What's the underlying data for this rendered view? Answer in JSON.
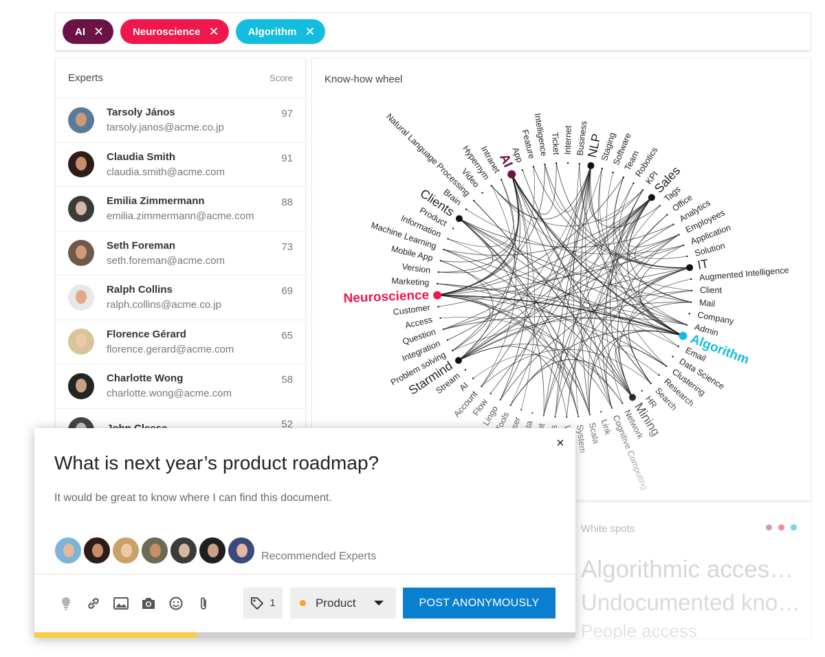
{
  "filters": [
    {
      "label": "AI",
      "color": "#6b1246"
    },
    {
      "label": "Neuroscience",
      "color": "#f0174a"
    },
    {
      "label": "Algorithm",
      "color": "#14bde0"
    }
  ],
  "experts_panel": {
    "title": "Experts",
    "score_label": "Score",
    "experts": [
      {
        "name": "Tarsoly János",
        "email": "tarsoly.janos@acme.co.jp",
        "score": "97"
      },
      {
        "name": "Claudia Smith",
        "email": "claudia.smith@acme.com",
        "score": "91"
      },
      {
        "name": "Emilia Zimmermann",
        "email": "emilia.zimmermann@acme.com",
        "score": "88"
      },
      {
        "name": "Seth Foreman",
        "email": "seth.foreman@acme.com",
        "score": "73"
      },
      {
        "name": "Ralph Collins",
        "email": "ralph.collins@acme.co.jp",
        "score": "69"
      },
      {
        "name": "Florence Gérard",
        "email": "florence.gerard@acme.com",
        "score": "65"
      },
      {
        "name": "Charlotte Wong",
        "email": "charlotte.wong@acme.com",
        "score": "58"
      },
      {
        "name": "John Cleese",
        "email": "",
        "score": "52"
      }
    ]
  },
  "wheel": {
    "title": "Know-how wheel",
    "labels": [
      {
        "text": "NLP",
        "major": true
      },
      {
        "text": "Staging"
      },
      {
        "text": "Software"
      },
      {
        "text": "Team"
      },
      {
        "text": "Robotics"
      },
      {
        "text": "KPI"
      },
      {
        "text": "Sales",
        "major": true
      },
      {
        "text": "Tags"
      },
      {
        "text": "Office"
      },
      {
        "text": "Analytics"
      },
      {
        "text": "Employees"
      },
      {
        "text": "Application"
      },
      {
        "text": "Solution"
      },
      {
        "text": "IT",
        "major": true
      },
      {
        "text": "Augmented Intelligence"
      },
      {
        "text": "Client"
      },
      {
        "text": "Mail"
      },
      {
        "text": "Company"
      },
      {
        "text": "Admin"
      },
      {
        "text": "Algorithm",
        "highlight": "#14bde0"
      },
      {
        "text": "Email"
      },
      {
        "text": "Data Science"
      },
      {
        "text": "Clustering"
      },
      {
        "text": "Research"
      },
      {
        "text": "Search"
      },
      {
        "text": "HR"
      },
      {
        "text": "Mining",
        "major": true
      },
      {
        "text": "Network"
      },
      {
        "text": "Cognitive Computing"
      },
      {
        "text": "Link"
      },
      {
        "text": "Scala"
      },
      {
        "text": "System"
      },
      {
        "text": "Website"
      },
      {
        "text": "Users"
      },
      {
        "text": "Chatbot"
      },
      {
        "text": "Data"
      },
      {
        "text": "Browser"
      },
      {
        "text": "Tools"
      },
      {
        "text": "Lingo"
      },
      {
        "text": "Flow"
      },
      {
        "text": "Account"
      },
      {
        "text": "AI"
      },
      {
        "text": "Stream"
      },
      {
        "text": "Starmind",
        "major": true
      },
      {
        "text": "Problem solving"
      },
      {
        "text": "Integration"
      },
      {
        "text": "Question"
      },
      {
        "text": "Access"
      },
      {
        "text": "Customer"
      },
      {
        "text": "Neuroscience",
        "highlight": "#f0174a"
      },
      {
        "text": "Marketing"
      },
      {
        "text": "Version"
      },
      {
        "text": "Mobile App"
      },
      {
        "text": "Machine Learning"
      },
      {
        "text": "Information"
      },
      {
        "text": "Product"
      },
      {
        "text": "Clients",
        "major": true
      },
      {
        "text": "Brain"
      },
      {
        "text": "Natural Language Processing"
      },
      {
        "text": "Video"
      },
      {
        "text": "Hypernym"
      },
      {
        "text": "Intranet"
      },
      {
        "text": "AI",
        "highlight": "#6b1246"
      },
      {
        "text": "App"
      },
      {
        "text": "Feature"
      },
      {
        "text": "Intelligence"
      },
      {
        "text": "Ticket"
      },
      {
        "text": "Internet"
      },
      {
        "text": "Business"
      }
    ]
  },
  "white_spots": {
    "title": "White spots",
    "dot_colors": [
      "#c7a0c9",
      "#f08aa4",
      "#6ad6ef"
    ],
    "items": [
      "Algorithmic acces…",
      "Undocumented kno…",
      "People access"
    ]
  },
  "question": {
    "title": "What is next year’s product roadmap?",
    "description": "It would be great to know where I can find this document.",
    "recommended_label": "Recommended Experts",
    "close_icon": "×",
    "tag_count": "1",
    "category": "Product",
    "post_label": "POST ANONYMOUSLY",
    "accent_color": "#0a7fcf"
  }
}
